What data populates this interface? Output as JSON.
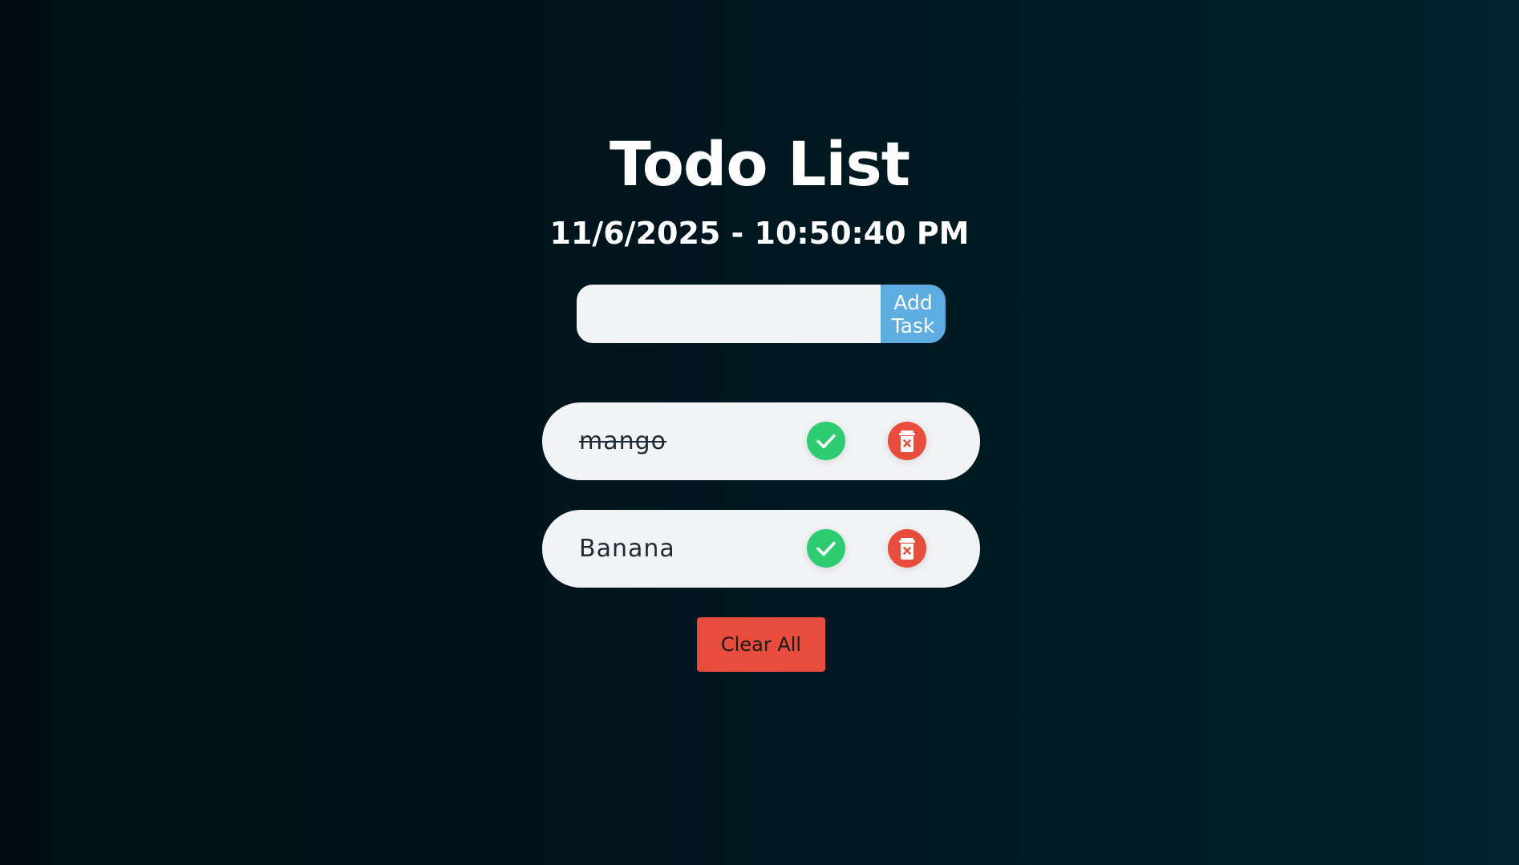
{
  "header": {
    "title": "Todo List",
    "datetime": "11/6/2025 - 10:50:40 PM"
  },
  "form": {
    "input_value": "",
    "input_placeholder": "",
    "add_label": "Add Task"
  },
  "tasks": [
    {
      "text": "mango",
      "completed": true,
      "complete_icon": "check-icon",
      "delete_icon": "trash-icon"
    },
    {
      "text": "Banana",
      "completed": false,
      "complete_icon": "check-icon",
      "delete_icon": "trash-icon"
    }
  ],
  "footer": {
    "clear_label": "Clear All"
  },
  "colors": {
    "background": "#001820",
    "accent_blue": "#5dade2",
    "complete_green": "#2ecc71",
    "delete_red": "#e74c3c",
    "item_bg": "#f2f3f5"
  }
}
